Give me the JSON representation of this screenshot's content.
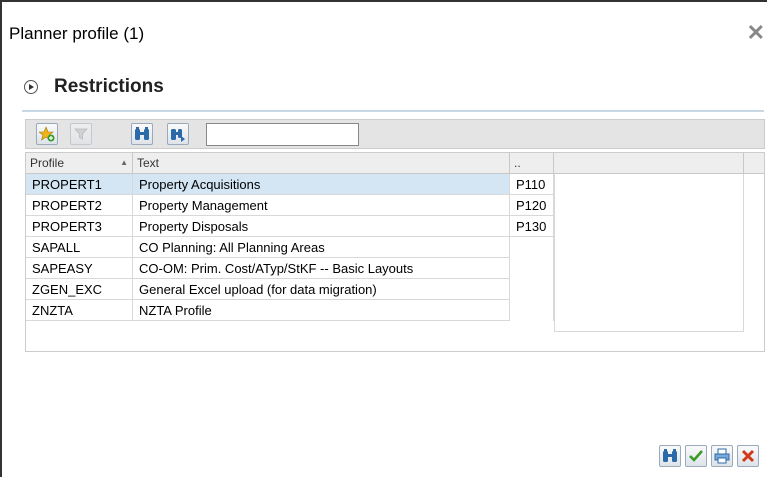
{
  "dialog": {
    "title": "Planner profile (1)",
    "close_icon": "close-icon"
  },
  "section": {
    "title": "Restrictions",
    "expander_icon": "expand-arrow-icon"
  },
  "toolbar": {
    "buttons": [
      {
        "icon": "add-favorite-icon",
        "enabled": true
      },
      {
        "icon": "filter-icon",
        "enabled": false
      },
      {
        "icon": "find-icon",
        "enabled": true
      },
      {
        "icon": "find-next-icon",
        "enabled": true
      }
    ],
    "search_value": ""
  },
  "table": {
    "columns": [
      "Profile",
      "Text",
      ".."
    ],
    "sort_indicator": "▲",
    "rows": [
      {
        "profile": "PROPERT1",
        "text": "Property Acquisitions",
        "extra": "P110",
        "selected": true
      },
      {
        "profile": "PROPERT2",
        "text": "Property Management",
        "extra": "P120",
        "selected": false
      },
      {
        "profile": "PROPERT3",
        "text": "Property Disposals",
        "extra": "P130",
        "selected": false
      },
      {
        "profile": "SAPALL",
        "text": "CO Planning: All Planning Areas",
        "extra": "",
        "selected": false
      },
      {
        "profile": "SAPEASY",
        "text": "CO-OM: Prim. Cost/ATyp/StKF -- Basic Layouts",
        "extra": "",
        "selected": false
      },
      {
        "profile": "ZGEN_EXC",
        "text": "General Excel upload (for data migration)",
        "extra": "",
        "selected": false
      },
      {
        "profile": "ZNZTA",
        "text": "NZTA Profile",
        "extra": "",
        "selected": false
      }
    ]
  },
  "footer": {
    "buttons": [
      {
        "icon": "find-icon"
      },
      {
        "icon": "checkmark-icon"
      },
      {
        "icon": "print-icon"
      },
      {
        "icon": "cancel-icon"
      }
    ]
  },
  "colors": {
    "selected_row": "#d4e6f4",
    "section_underline": "#c8d8e4",
    "confirm_green": "#3a9a2a",
    "cancel_red": "#d03a1a"
  }
}
